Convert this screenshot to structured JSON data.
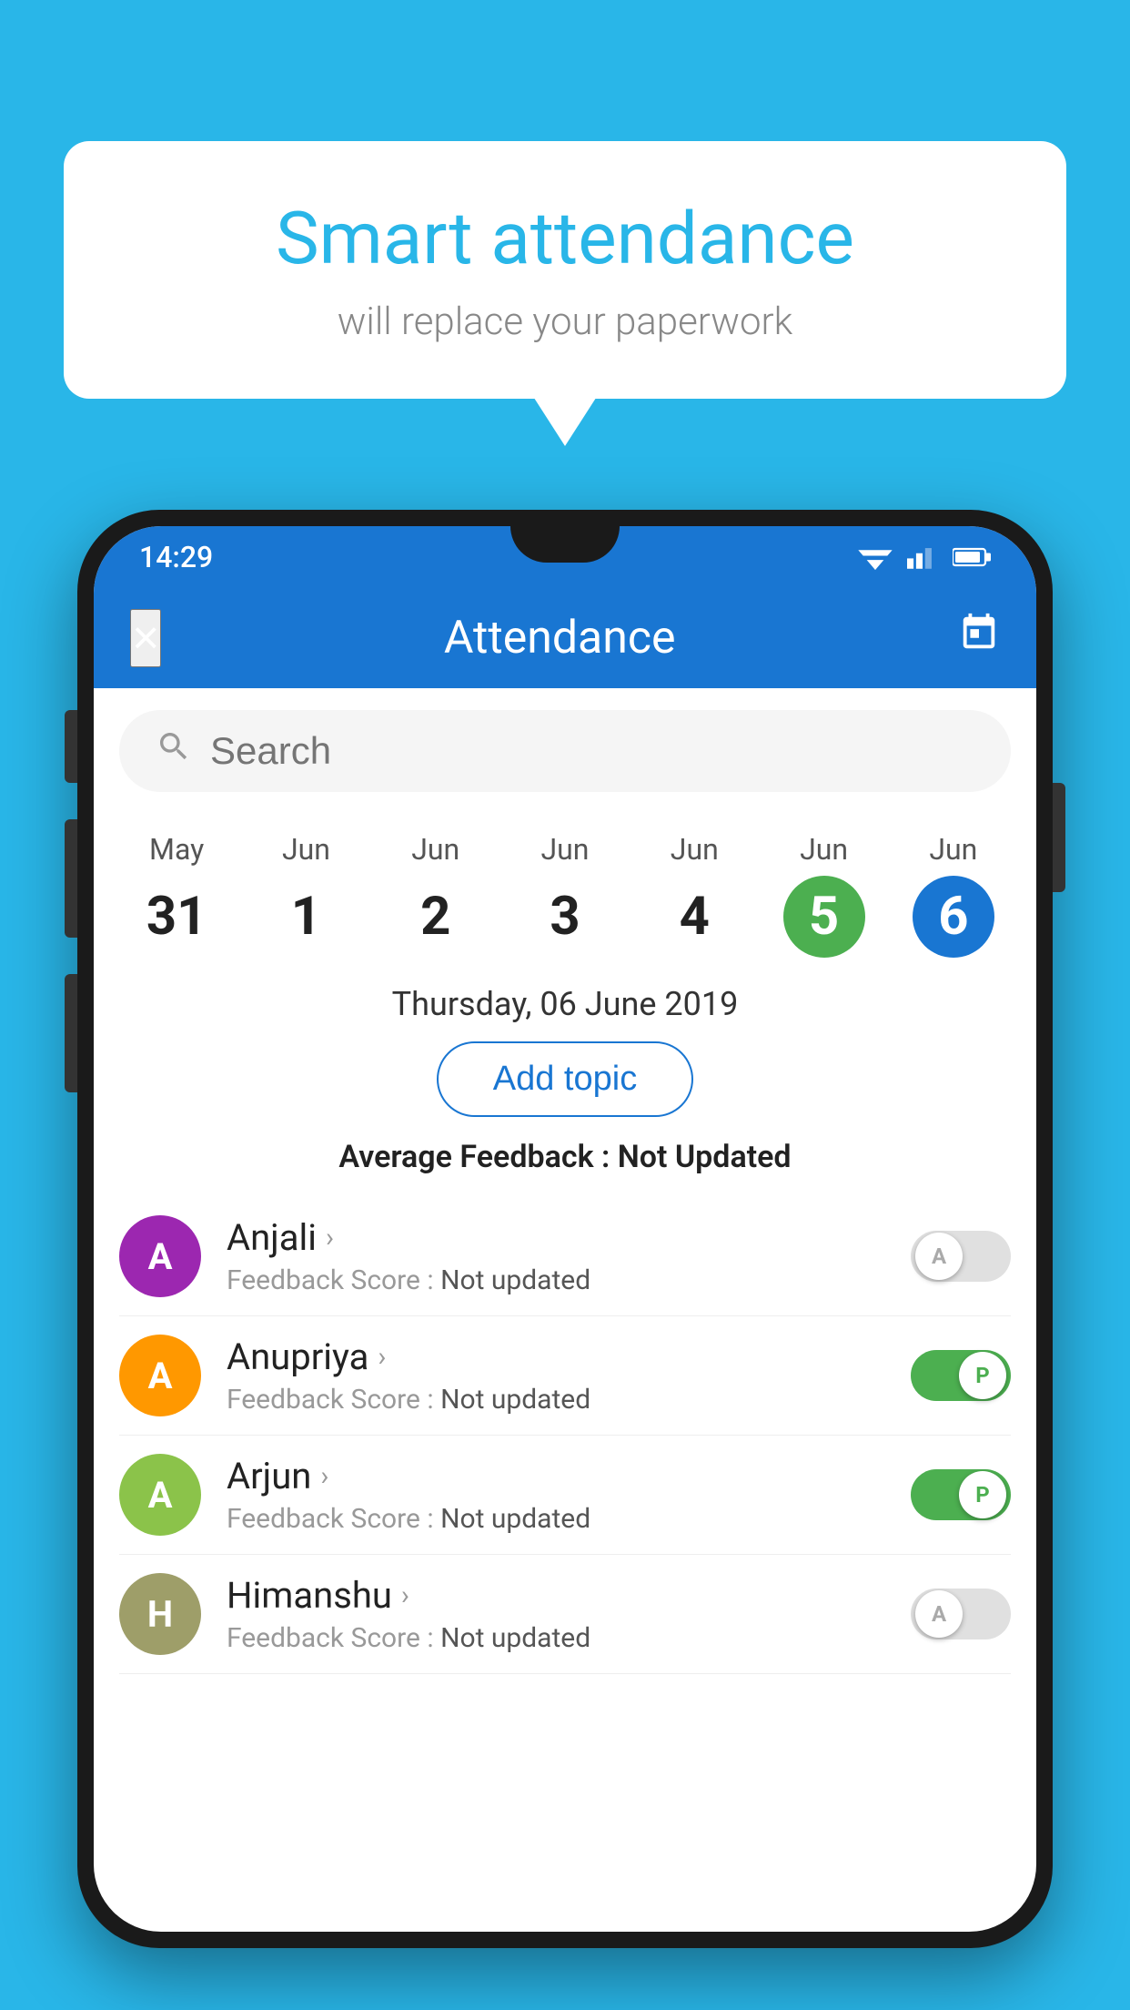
{
  "background_color": "#29B6E8",
  "bubble": {
    "title": "Smart attendance",
    "subtitle": "will replace your paperwork"
  },
  "phone": {
    "status_bar": {
      "time": "14:29"
    },
    "app_bar": {
      "title": "Attendance",
      "close_label": "×",
      "calendar_icon": "📅"
    },
    "search": {
      "placeholder": "Search"
    },
    "dates": [
      {
        "month": "May",
        "day": "31",
        "style": "normal"
      },
      {
        "month": "Jun",
        "day": "1",
        "style": "normal"
      },
      {
        "month": "Jun",
        "day": "2",
        "style": "normal"
      },
      {
        "month": "Jun",
        "day": "3",
        "style": "normal"
      },
      {
        "month": "Jun",
        "day": "4",
        "style": "normal"
      },
      {
        "month": "Jun",
        "day": "5",
        "style": "green"
      },
      {
        "month": "Jun",
        "day": "6",
        "style": "blue"
      }
    ],
    "selected_date": "Thursday, 06 June 2019",
    "add_topic_label": "Add topic",
    "avg_feedback_label": "Average Feedback :",
    "avg_feedback_value": "Not Updated",
    "students": [
      {
        "name": "Anjali",
        "initial": "A",
        "avatar_color": "purple",
        "feedback_label": "Feedback Score :",
        "feedback_value": "Not updated",
        "toggle_state": "off",
        "toggle_label": "A"
      },
      {
        "name": "Anupriya",
        "initial": "A",
        "avatar_color": "orange",
        "feedback_label": "Feedback Score :",
        "feedback_value": "Not updated",
        "toggle_state": "on",
        "toggle_label": "P"
      },
      {
        "name": "Arjun",
        "initial": "A",
        "avatar_color": "light-green",
        "feedback_label": "Feedback Score :",
        "feedback_value": "Not updated",
        "toggle_state": "on",
        "toggle_label": "P"
      },
      {
        "name": "Himanshu",
        "initial": "H",
        "avatar_color": "olive",
        "feedback_label": "Feedback Score :",
        "feedback_value": "Not updated",
        "toggle_state": "off",
        "toggle_label": "A"
      }
    ]
  }
}
